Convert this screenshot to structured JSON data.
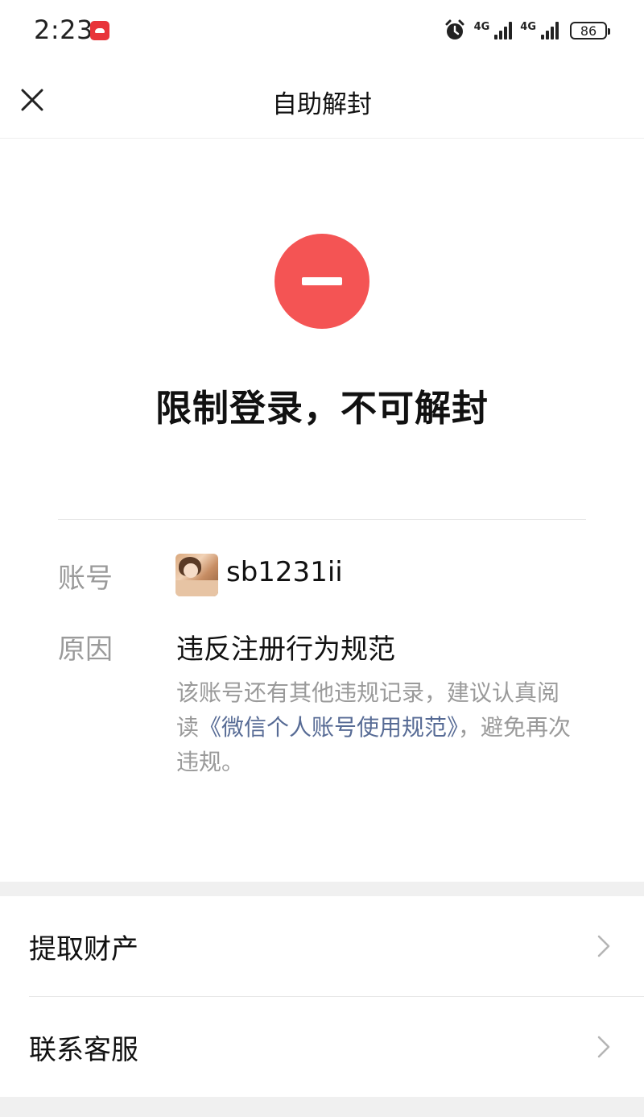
{
  "status_bar": {
    "time": "2:23",
    "network_1": "4G",
    "network_2": "4G",
    "battery": "86",
    "icons": [
      "huawei-app-icon",
      "alarm-icon",
      "signal-icon",
      "signal-icon",
      "battery-icon"
    ]
  },
  "nav": {
    "title": "自助解封",
    "close_icon": "close-icon"
  },
  "result": {
    "icon": "minus-circle-icon",
    "icon_color": "#f45454",
    "headline": "限制登录，不可解封"
  },
  "account": {
    "label": "账号",
    "name": "sb1231ii"
  },
  "reason": {
    "label": "原因",
    "title": "违反注册行为规范",
    "desc_before": "该账号还有其他违规记录，建议认真阅读",
    "desc_link": "《微信个人账号使用规范》",
    "desc_after": "，避免再次违规。",
    "link_color": "#576b95"
  },
  "menu": {
    "items": [
      {
        "label": "提取财产"
      },
      {
        "label": "联系客服"
      }
    ]
  }
}
